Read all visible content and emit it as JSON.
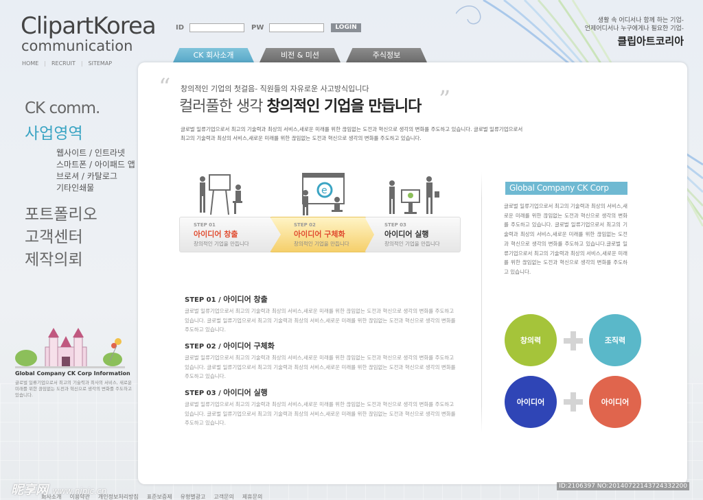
{
  "brand": {
    "logo_main": "ClipartKorea",
    "logo_sub": "communication"
  },
  "topnav": [
    "HOME",
    "RECRUIT",
    "SITEMAP"
  ],
  "login": {
    "id_label": "ID",
    "pw_label": "PW",
    "button": "LOGIN"
  },
  "tagline": {
    "line1": "생활 속 어디서나 함께 하는 기업-",
    "line2": "언제어디서나 누구에게나 필요한 기업-",
    "brand": "클립아트코리아"
  },
  "tabs": [
    "CK 회사소개",
    "비전 & 미션",
    "주식정보"
  ],
  "leftmenu": {
    "title": "CK comm.",
    "active": "사업영역",
    "sub": [
      "웹사이트 / 인트라넷",
      "스마트폰 / 아이패드 앱",
      "브로셔 / 카탈로그",
      "기타인쇄물"
    ],
    "items": [
      "포트폴리오",
      "고객센터",
      "제작의뢰"
    ]
  },
  "info": {
    "title": "Global Company CK Corp  Information",
    "text": "글로벌 일류기업으로서 최고의 기술력과 최사의 서비스, 새로운 미래를 위한 끊임없는 도전과 혁신으로 생각의 변화를 주도하고 있습니다."
  },
  "hero": {
    "small": "창의적인 기업의 첫걸음- 직원들의 자유로운 사고방식입니다",
    "big_light": "컬러풀한 생각 ",
    "big_bold": "창의적인 기업을 만듭니다",
    "desc": "글로벌 일류기업으로서 최고의 기술력과 최상의 서비스,새로운 미래를 위한 끊임없는 도전과 혁신으로 생각의 변화를 주도하고 있습니다. 글로벌 일류기업으로서 최고의 기술력과 최상의 서비스,새로운 미래를 위한 끊임없는 도전과 혁신으로 생각의 변화를 주도하고 있습니다."
  },
  "steps": [
    {
      "no": "STEP 01",
      "name": "아이디어 창출",
      "desc": "창의적인 기업을 만듭니다"
    },
    {
      "no": "STEP 02",
      "name": "아이디어 구체화",
      "desc": "창의적인 기업을 만듭니다"
    },
    {
      "no": "STEP 03",
      "name": "아이디어 실행",
      "desc": "창의적인 기업을 만듭니다"
    }
  ],
  "details": [
    {
      "step": "STEP 01  /",
      "name": "아이디어 창출",
      "text": "글로벌 일류기업으로서 최고의 기술력과 최상의 서비스,새로운 미래를 위한 끊임없는 도전과 혁신으로 생각의 변화를 주도하고 있습니다. 글로벌 일류기업으로서 최고의 기술력과 최상의 서비스,새로운 미래를 위한 끊임없는 도전과 혁신으로 생각의 변화를 주도하고 있습니다."
    },
    {
      "step": "STEP 02  /",
      "name": "아이디어 구체화",
      "text": "글로벌 일류기업으로서 최고의 기술력과 최상의 서비스,새로운 미래를 위한 끊임없는 도전과 혁신으로 생각의 변화를 주도하고 있습니다. 글로벌 일류기업으로서 최고의 기술력과 최상의 서비스,새로운 미래를 위한 끊임없는 도전과 혁신으로 생각의 변화를 주도하고 있습니다."
    },
    {
      "step": "STEP 03  /",
      "name": "아이디어 실행",
      "text": "글로벌 일류기업으로서 최고의 기술력과 최상의 서비스,새로운 미래를 위한 끊임없는 도전과 혁신으로 생각의 변화를 주도하고 있습니다. 글로벌 일류기업으로서 최고의 기술력과 최상의 서비스,새로운 미래를 위한 끊임없는 도전과 혁신으로 생각의 변화를 주도하고 있습니다."
    }
  ],
  "global": {
    "title": "Global Company CK Corp",
    "text": "글로벌 일류기업으로서 최고의 기술력과 최상의 서비스,새로운 미래를 위한 끊임없는 도전과 혁신으로 생각의 변화를 주도하고 있습니다. 글로벌 일류기업으로서 최고의 기술력과 최상의 서비스,새로운 미래를 위한 끊임없는 도전과 혁신으로 생각의 변화를 주도하고 있습니다.글로벌 일류기업으로서 최고의 기술력과 최상의 서비스,새로운 미래를 위한 끊임없는 도전과 혁신으로 생각의 변화를 주도하고 있습니다."
  },
  "circles": [
    {
      "label": "창의력",
      "color": "#a5c43a"
    },
    {
      "label": "조직력",
      "color": "#5ab8c9"
    },
    {
      "label": "아이디어",
      "color": "#2f45b6"
    },
    {
      "label": "아이디어",
      "color": "#e0654d"
    }
  ],
  "footer": [
    "회사소개",
    "이용약관",
    "개인정보처리방침",
    "표준보증제",
    "유형별광고",
    "고객문의",
    "제휴문의"
  ],
  "watermark": {
    "left_main": "昵享网",
    "left_url": "www.nipic.cn",
    "right": "ID:2106397 NO:20140722143724332200"
  }
}
